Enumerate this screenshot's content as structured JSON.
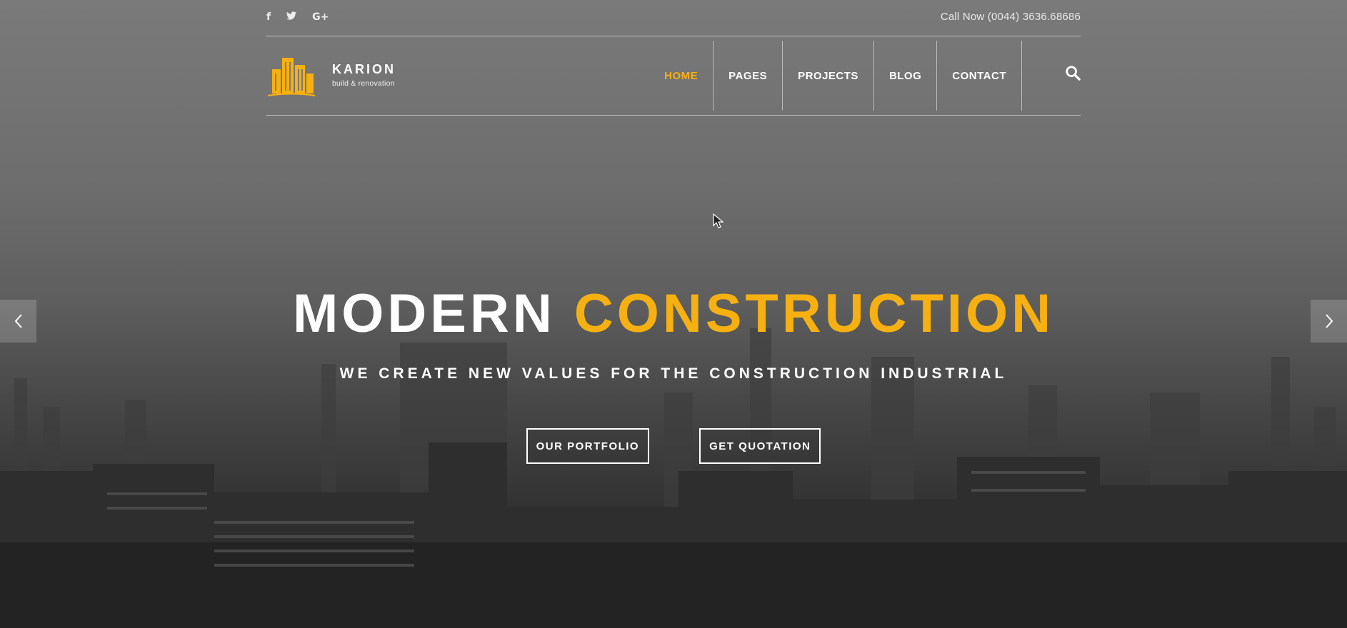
{
  "colors": {
    "accent": "#f6b012",
    "text": "#ffffff"
  },
  "topbar": {
    "social": [
      {
        "name": "facebook-icon",
        "glyph": "f"
      },
      {
        "name": "twitter-icon",
        "glyph": "t"
      },
      {
        "name": "google-plus-icon",
        "glyph": "G+"
      }
    ],
    "call_now": "Call Now (0044) 3636.68686"
  },
  "logo": {
    "name": "KARION",
    "tagline": "build & renovation"
  },
  "menu": {
    "items": [
      {
        "label": "HOME",
        "active": true
      },
      {
        "label": "PAGES",
        "active": false
      },
      {
        "label": "PROJECTS",
        "active": false
      },
      {
        "label": "BLOG",
        "active": false
      },
      {
        "label": "CONTACT",
        "active": false
      }
    ],
    "search_icon": "search-icon"
  },
  "hero": {
    "title_part1": "MODERN",
    "title_part2": "CONSTRUCTION",
    "subtitle": "WE CREATE NEW VALUES FOR THE CONSTRUCTION INDUSTRIAL",
    "buttons": {
      "portfolio": "OUR PORTFOLIO",
      "quotation": "GET QUOTATION"
    },
    "prev_icon": "chevron-left-icon",
    "next_icon": "chevron-right-icon"
  }
}
